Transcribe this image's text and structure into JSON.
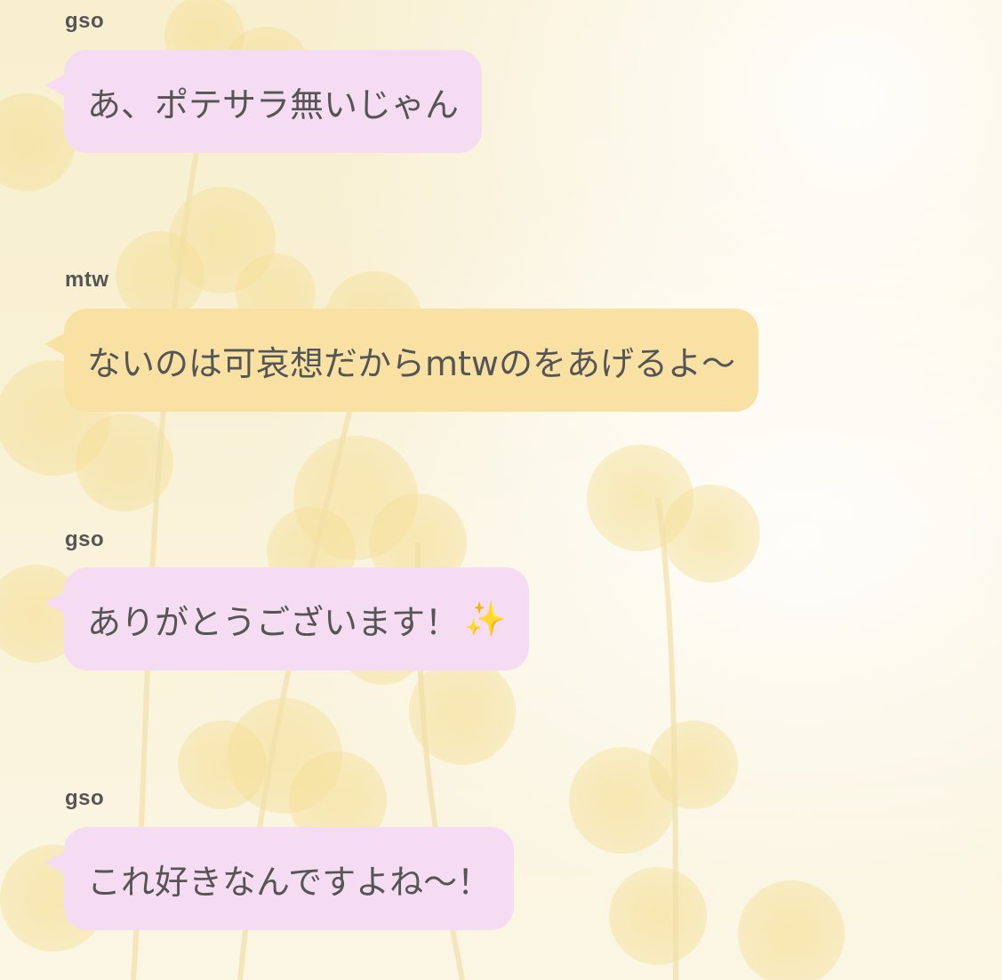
{
  "messages": [
    {
      "sender": "gso",
      "text": "あ、ポテサラ無いじゃん",
      "color": "#f6dcf3"
    },
    {
      "sender": "mtw",
      "text": "ないのは可哀想だからmtwのをあげるよ〜",
      "color": "#f8e1a3"
    },
    {
      "sender": "gso",
      "text": "ありがとうございます！",
      "emoji": "✨",
      "color": "#f6dcf3"
    },
    {
      "sender": "gso",
      "text": "これ好きなんですよね〜！",
      "color": "#f6dcf3"
    }
  ]
}
